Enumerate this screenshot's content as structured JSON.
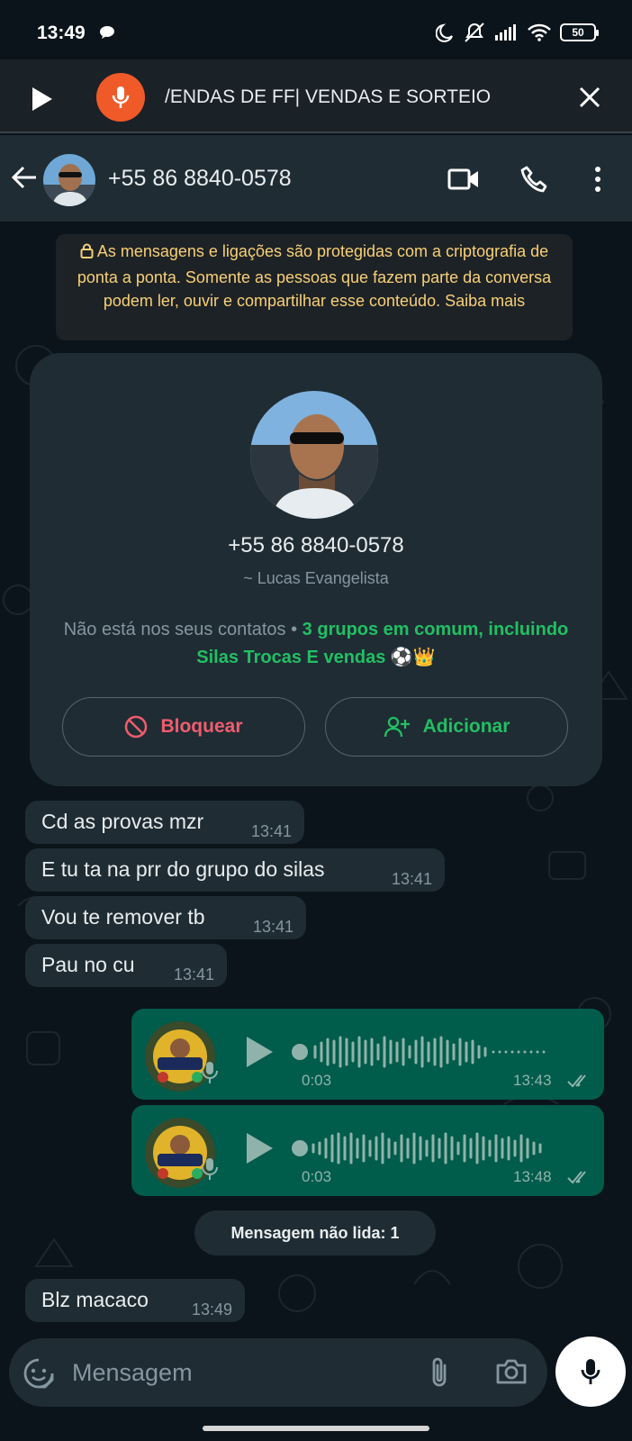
{
  "status_bar": {
    "time": "13:49",
    "battery": "50"
  },
  "notification": {
    "text": "/ENDAS DE FF| VENDAS E SORTEIO"
  },
  "header": {
    "title": "+55 86 8840-0578"
  },
  "encryption_notice": "As mensagens e ligações são protegidas com a criptografia de ponta a ponta. Somente as pessoas que fazem parte da conversa podem ler, ouvir e compartilhar esse conteúdo. Saiba mais",
  "contact_card": {
    "number": "+55 86 8840-0578",
    "name": "~ Lucas Evangelista",
    "not_in_contacts": "Não está nos seus contatos • ",
    "groups": "3 grupos em comum, incluindo Silas Trocas E vendas ⚽👑",
    "block_label": "Bloquear",
    "add_label": "Adicionar"
  },
  "messages_in": [
    {
      "text": "Cd as provas mzr",
      "time": "13:41"
    },
    {
      "text": "E tu ta na prr do grupo do silas",
      "time": "13:41"
    },
    {
      "text": "Vou te remover tb",
      "time": "13:41"
    },
    {
      "text": "Pau no cu",
      "time": "13:41"
    },
    {
      "text": "Blz macaco",
      "time": "13:49"
    }
  ],
  "voice_messages": [
    {
      "duration": "0:03",
      "time": "13:43"
    },
    {
      "duration": "0:03",
      "time": "13:48"
    }
  ],
  "unread_label": "Mensagem não lida: 1",
  "input": {
    "placeholder": "Mensagem"
  },
  "colors": {
    "background": "#0b141a",
    "bubble_in": "#1f2c34",
    "bubble_out": "#005c4b",
    "accent_green": "#21c063",
    "block_red": "#f15c6d",
    "encryption_yellow": "#f8d076"
  }
}
